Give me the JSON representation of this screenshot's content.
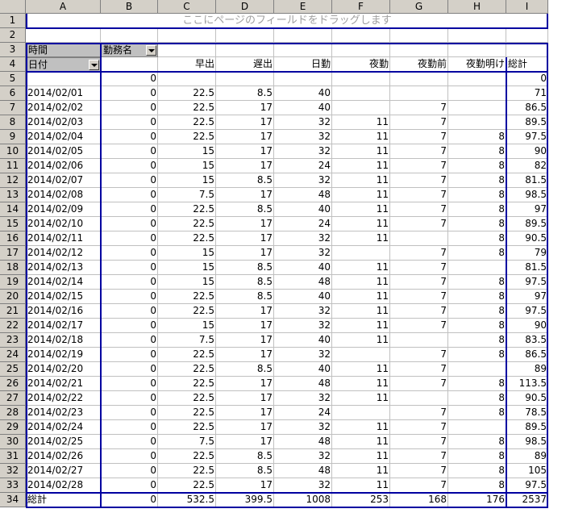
{
  "columns": [
    "A",
    "B",
    "C",
    "D",
    "E",
    "F",
    "G",
    "H",
    "I"
  ],
  "rows": [
    "1",
    "2",
    "3",
    "4",
    "5",
    "6",
    "7",
    "8",
    "9",
    "10",
    "11",
    "12",
    "13",
    "14",
    "15",
    "16",
    "17",
    "18",
    "19",
    "20",
    "21",
    "22",
    "23",
    "24",
    "25",
    "26",
    "27",
    "28",
    "29",
    "30",
    "31",
    "32",
    "33",
    "34"
  ],
  "page_field_hint": "ここにページのフィールドをドラッグします",
  "row_field_label_time": "時間",
  "col_field_label": "勤務名",
  "row_field_label_date": "日付",
  "col_headers": [
    "",
    "早出",
    "遅出",
    "日勤",
    "夜勤",
    "夜勤前",
    "夜勤明け",
    "総計"
  ],
  "data_rows": [
    [
      "",
      "0",
      "",
      "",
      "",
      "",
      "",
      "",
      "0"
    ],
    [
      "2014/02/01",
      "0",
      "22.5",
      "8.5",
      "40",
      "",
      "",
      "",
      "71"
    ],
    [
      "2014/02/02",
      "0",
      "22.5",
      "17",
      "40",
      "",
      "7",
      "",
      "86.5"
    ],
    [
      "2014/02/03",
      "0",
      "22.5",
      "17",
      "32",
      "11",
      "7",
      "",
      "89.5"
    ],
    [
      "2014/02/04",
      "0",
      "22.5",
      "17",
      "32",
      "11",
      "7",
      "8",
      "97.5"
    ],
    [
      "2014/02/05",
      "0",
      "15",
      "17",
      "32",
      "11",
      "7",
      "8",
      "90"
    ],
    [
      "2014/02/06",
      "0",
      "15",
      "17",
      "24",
      "11",
      "7",
      "8",
      "82"
    ],
    [
      "2014/02/07",
      "0",
      "15",
      "8.5",
      "32",
      "11",
      "7",
      "8",
      "81.5"
    ],
    [
      "2014/02/08",
      "0",
      "7.5",
      "17",
      "48",
      "11",
      "7",
      "8",
      "98.5"
    ],
    [
      "2014/02/09",
      "0",
      "22.5",
      "8.5",
      "40",
      "11",
      "7",
      "8",
      "97"
    ],
    [
      "2014/02/10",
      "0",
      "22.5",
      "17",
      "24",
      "11",
      "7",
      "8",
      "89.5"
    ],
    [
      "2014/02/11",
      "0",
      "22.5",
      "17",
      "32",
      "11",
      "",
      "8",
      "90.5"
    ],
    [
      "2014/02/12",
      "0",
      "15",
      "17",
      "32",
      "",
      "7",
      "8",
      "79"
    ],
    [
      "2014/02/13",
      "0",
      "15",
      "8.5",
      "40",
      "11",
      "7",
      "",
      "81.5"
    ],
    [
      "2014/02/14",
      "0",
      "15",
      "8.5",
      "48",
      "11",
      "7",
      "8",
      "97.5"
    ],
    [
      "2014/02/15",
      "0",
      "22.5",
      "8.5",
      "40",
      "11",
      "7",
      "8",
      "97"
    ],
    [
      "2014/02/16",
      "0",
      "22.5",
      "17",
      "32",
      "11",
      "7",
      "8",
      "97.5"
    ],
    [
      "2014/02/17",
      "0",
      "15",
      "17",
      "32",
      "11",
      "7",
      "8",
      "90"
    ],
    [
      "2014/02/18",
      "0",
      "7.5",
      "17",
      "40",
      "11",
      "",
      "8",
      "83.5"
    ],
    [
      "2014/02/19",
      "0",
      "22.5",
      "17",
      "32",
      "",
      "7",
      "8",
      "86.5"
    ],
    [
      "2014/02/20",
      "0",
      "22.5",
      "8.5",
      "40",
      "11",
      "7",
      "",
      "89"
    ],
    [
      "2014/02/21",
      "0",
      "22.5",
      "17",
      "48",
      "11",
      "7",
      "8",
      "113.5"
    ],
    [
      "2014/02/22",
      "0",
      "22.5",
      "17",
      "32",
      "11",
      "",
      "8",
      "90.5"
    ],
    [
      "2014/02/23",
      "0",
      "22.5",
      "17",
      "24",
      "",
      "7",
      "8",
      "78.5"
    ],
    [
      "2014/02/24",
      "0",
      "22.5",
      "17",
      "32",
      "11",
      "7",
      "",
      "89.5"
    ],
    [
      "2014/02/25",
      "0",
      "7.5",
      "17",
      "48",
      "11",
      "7",
      "8",
      "98.5"
    ],
    [
      "2014/02/26",
      "0",
      "22.5",
      "8.5",
      "32",
      "11",
      "7",
      "8",
      "89"
    ],
    [
      "2014/02/27",
      "0",
      "22.5",
      "8.5",
      "48",
      "11",
      "7",
      "8",
      "105"
    ],
    [
      "2014/02/28",
      "0",
      "22.5",
      "17",
      "32",
      "11",
      "7",
      "8",
      "97.5"
    ],
    [
      "総計",
      "0",
      "532.5",
      "399.5",
      "1008",
      "253",
      "168",
      "176",
      "2537"
    ]
  ]
}
